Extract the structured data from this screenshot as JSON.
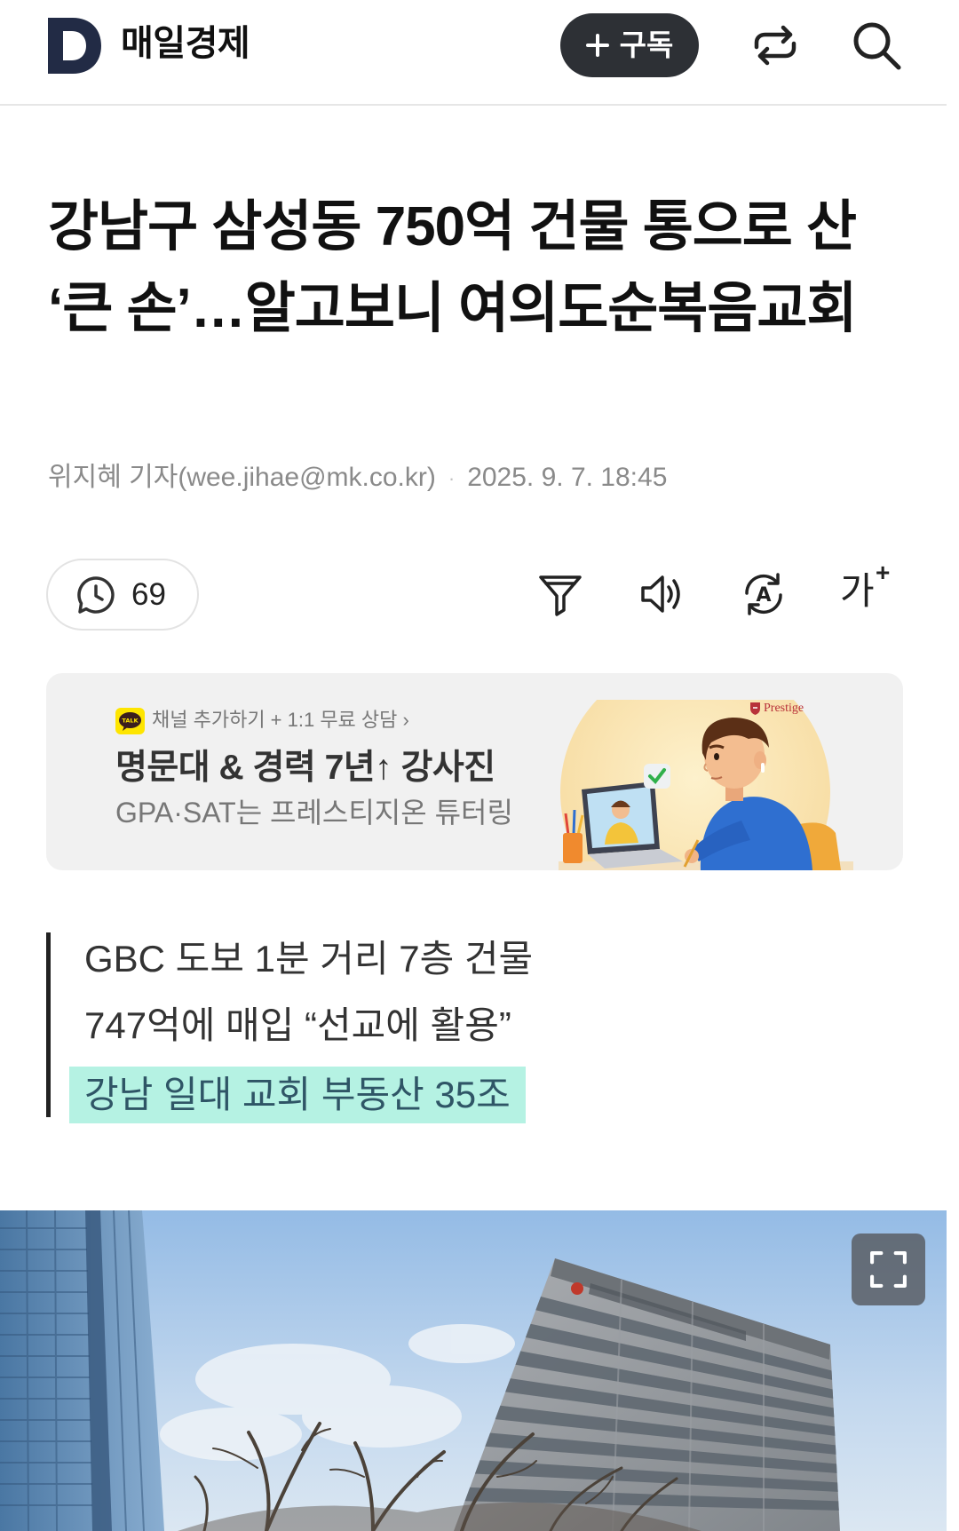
{
  "header": {
    "logo_letter": "D",
    "brand_name": "매일경제",
    "subscribe_label": "구독",
    "icons": [
      "plus-icon",
      "share-icon",
      "search-icon"
    ]
  },
  "article": {
    "title": "강남구 삼성동 750억 건물 통으로 산 ‘큰 손’…알고보니 여의도순복음교회",
    "author": "위지혜 기자(wee.jihae@mk.co.kr)",
    "separator": "·",
    "published": "2025. 9. 7. 18:45"
  },
  "toolbar": {
    "comment_count": "69",
    "translate_letter": "A",
    "font_size_glyph": "가",
    "font_size_plus": "+",
    "icons": [
      "comment-icon",
      "filter-icon",
      "speaker-icon",
      "translate-icon",
      "font-size-icon"
    ]
  },
  "ad_banner": {
    "kakao_badge": "TALK",
    "channel_cta": "채널 추가하기 + 1:1 무료 상담 ›",
    "headline": "명문대 & 경력 7년↑ 강사진",
    "subline": "GPA·SAT는 프레스티지온 튜터링",
    "advertiser_logo": "Prestige"
  },
  "summary": {
    "lines": [
      "GBC 도보 1분 거리 7층 건물",
      "747억에 매입 “선교에 활용”"
    ],
    "highlighted_line": "강남 일대 교회 부동산 35조"
  },
  "photo": {
    "icons": [
      "fullscreen-icon"
    ]
  },
  "colors": {
    "logo": "#222b45",
    "subscribe_bg": "#2d3035",
    "highlight": "#b5f2e3",
    "ad_bg": "#f1f1f1",
    "kakao_yellow": "#fee500"
  }
}
